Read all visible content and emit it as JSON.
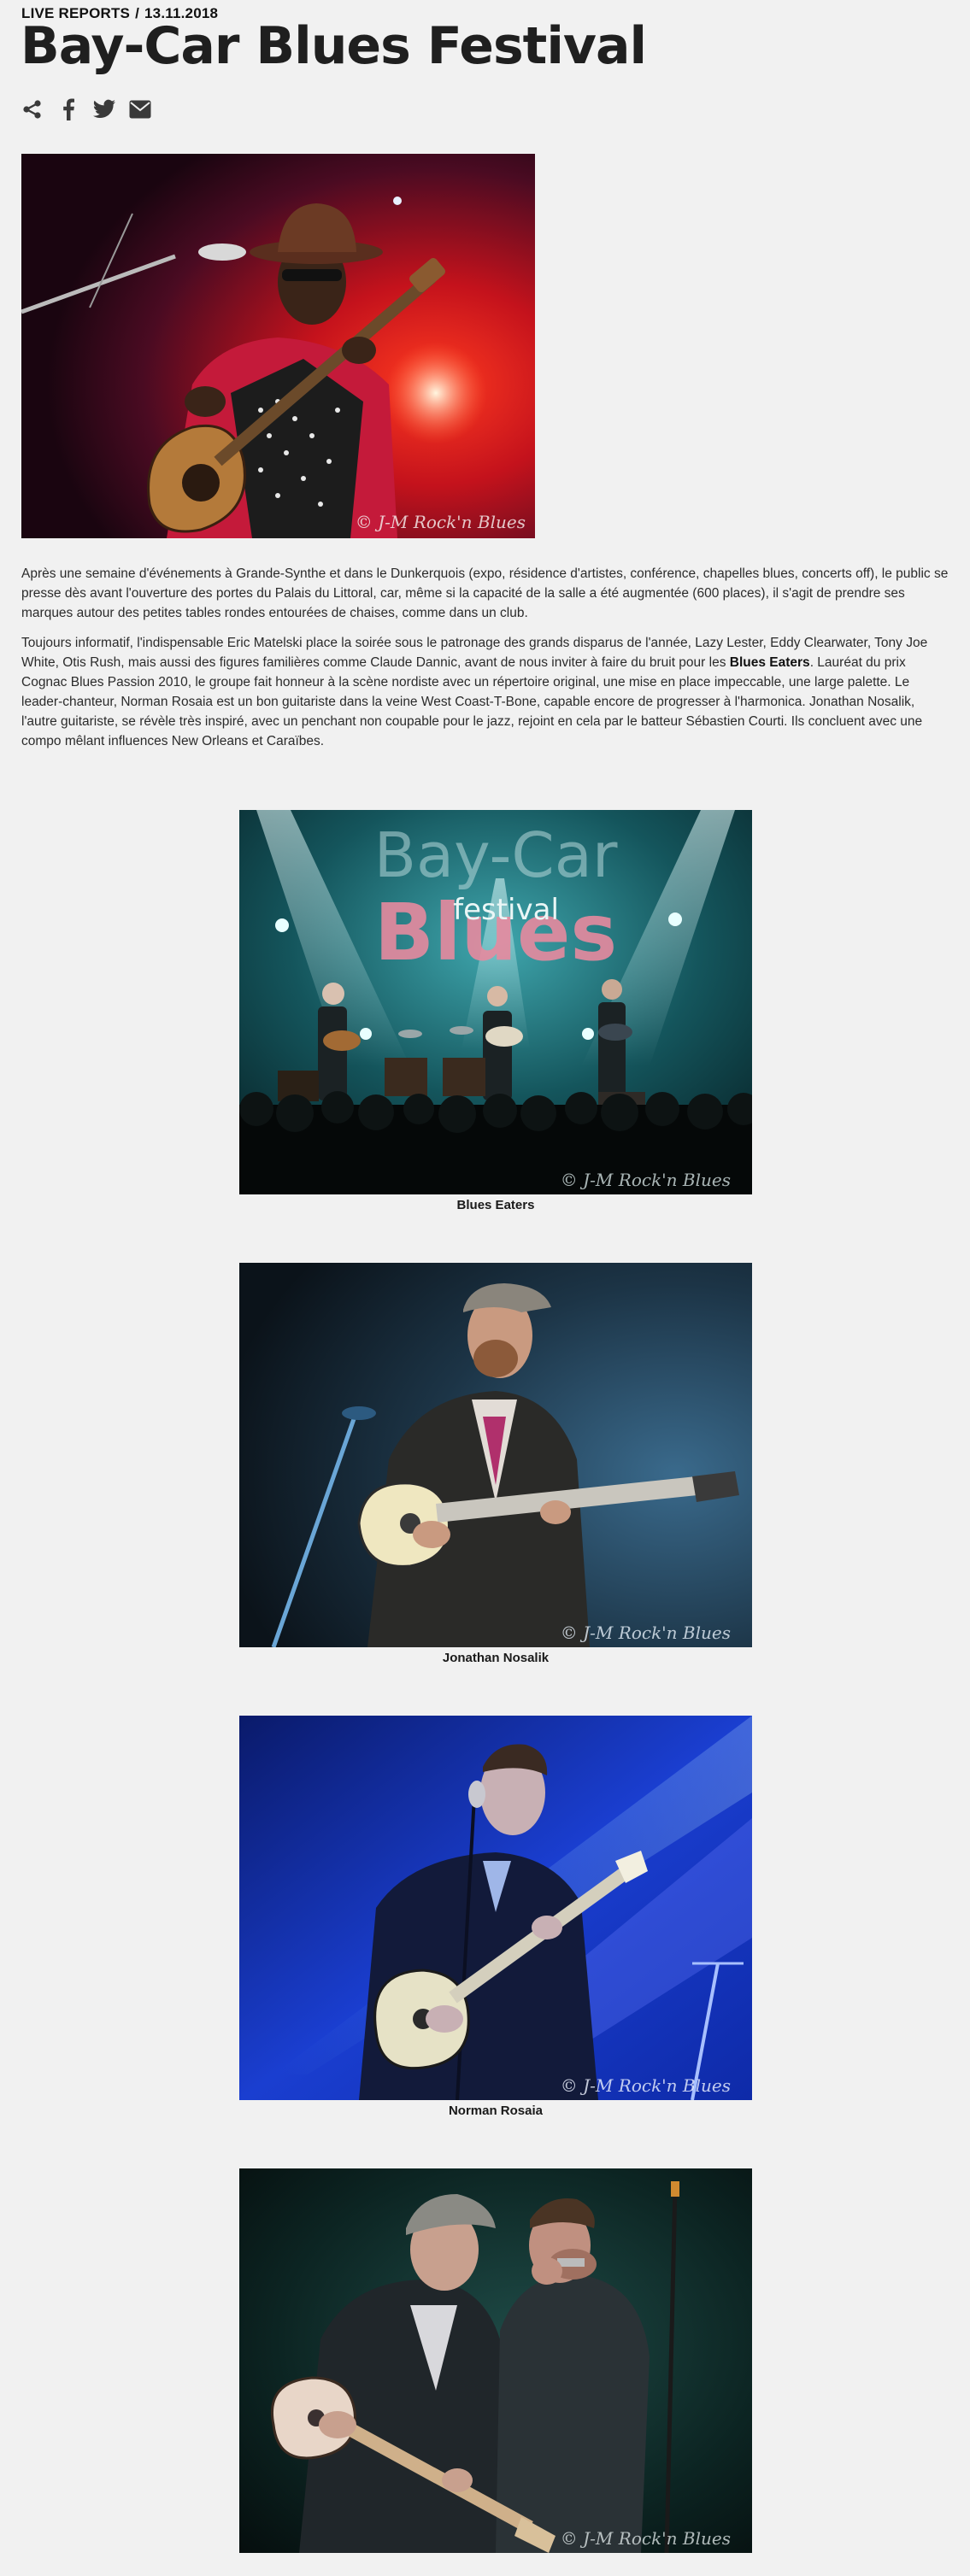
{
  "header": {
    "category": "LIVE REPORTS",
    "separator": "/",
    "date": "13.11.2018",
    "title": "Bay-Car Blues Festival"
  },
  "share": {
    "icons": [
      "share-icon",
      "facebook-icon",
      "twitter-icon",
      "email-icon"
    ],
    "color": "#3a3a3a"
  },
  "hero_image": {
    "watermark": "© J-M Rock'n Blues"
  },
  "article": {
    "paragraph1": "Après une semaine d'événements à Grande-Synthe et dans le Dunkerquois (expo, résidence d'artistes, conférence, chapelles blues, concerts off), le public se presse dès avant l'ouverture des portes du Palais du Littoral, car, même si la capacité de la salle a été augmentée (600 places), il s'agit de prendre ses marques autour des petites tables rondes entourées de chaises, comme dans un club.",
    "paragraph2_before": "Toujours informatif, l'indispensable Eric Matelski place la soirée sous le patronage des grands disparus de l'année, Lazy Lester, Eddy Clearwater, Tony Joe White, Otis Rush, mais aussi des figures familières comme Claude Dannic, avant de nous inviter à faire du bruit pour les ",
    "paragraph2_bold": "Blues Eaters",
    "paragraph2_after": ". Lauréat du prix Cognac Blues Passion 2010, le groupe fait honneur à la scène nordiste avec un répertoire original, une mise en place impeccable, une large palette. Le leader-chanteur, Norman Rosaia est un bon guitariste dans la veine West Coast-T-Bone, capable encore de progresser à l'harmonica. Jonathan Nosalik, l'autre guitariste, se révèle très inspiré, avec un penchant non coupable pour le jazz, rejoint en cela par le batteur Sébastien Courti. Ils concluent avec une compo mêlant influences New Orleans et Caraïbes."
  },
  "figures": [
    {
      "caption": "Blues Eaters",
      "watermark": "© J-M Rock'n Blues",
      "stage_sign_top": "Bay-Car",
      "stage_sign_mid": "festival",
      "stage_sign_bottom": "Blues"
    },
    {
      "caption": "Jonathan Nosalik",
      "watermark": "© J-M Rock'n Blues"
    },
    {
      "caption": "Norman Rosaia",
      "watermark": "© J-M Rock'n Blues"
    },
    {
      "caption": "",
      "watermark": "© J-M Rock'n Blues"
    }
  ]
}
